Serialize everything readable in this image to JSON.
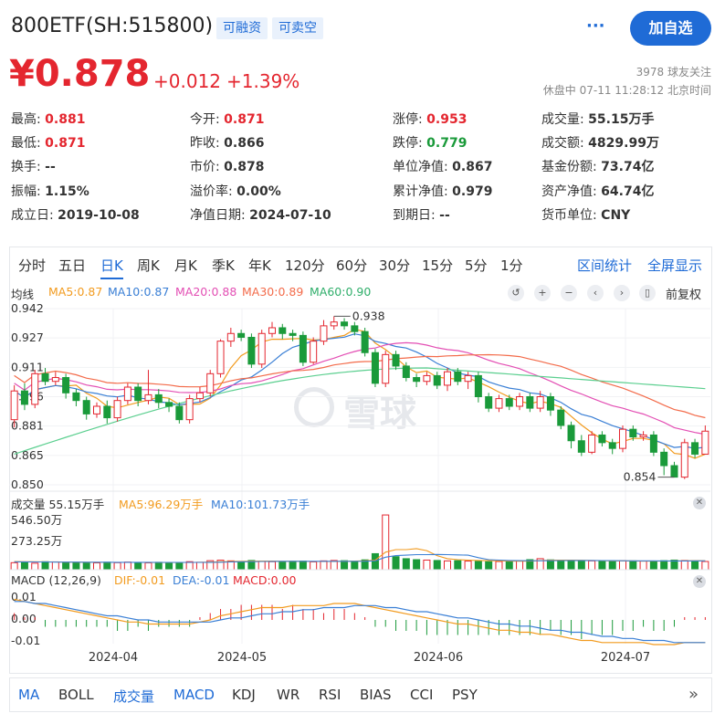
{
  "header": {
    "title": "800ETF(SH:515800)",
    "tags": [
      "可融资",
      "可卖空"
    ],
    "more": "···",
    "add_button": "加自选"
  },
  "quote": {
    "price": "¥0.878",
    "change": "+0.012",
    "change_pct": "+1.39%",
    "followers": "3978 球友关注",
    "status": "休盘中 07-11 11:28:12 北京时间"
  },
  "info": {
    "rows": [
      [
        {
          "label": "最高:",
          "value": "0.881",
          "color": "red"
        },
        {
          "label": "今开:",
          "value": "0.871",
          "color": "red"
        },
        {
          "label": "涨停:",
          "value": "0.953",
          "color": "red"
        },
        {
          "label": "成交量:",
          "value": "55.15万手",
          "color": "black"
        }
      ],
      [
        {
          "label": "最低:",
          "value": "0.871",
          "color": "red"
        },
        {
          "label": "昨收:",
          "value": "0.866",
          "color": "black"
        },
        {
          "label": "跌停:",
          "value": "0.779",
          "color": "green"
        },
        {
          "label": "成交额:",
          "value": "4829.99万",
          "color": "black"
        }
      ],
      [
        {
          "label": "换手:",
          "value": "--",
          "color": "black"
        },
        {
          "label": "市价:",
          "value": "0.878",
          "color": "black"
        },
        {
          "label": "单位净值:",
          "value": "0.867",
          "color": "black"
        },
        {
          "label": "基金份额:",
          "value": "73.74亿",
          "color": "black"
        }
      ],
      [
        {
          "label": "振幅:",
          "value": "1.15%",
          "color": "black"
        },
        {
          "label": "溢价率:",
          "value": "0.00%",
          "color": "black"
        },
        {
          "label": "累计净值:",
          "value": "0.979",
          "color": "black"
        },
        {
          "label": "资产净值:",
          "value": "64.74亿",
          "color": "black"
        }
      ],
      [
        {
          "label": "成立日:",
          "value": "2019-10-08",
          "color": "black"
        },
        {
          "label": "净值日期:",
          "value": "2024-07-10",
          "color": "black"
        },
        {
          "label": "到期日:",
          "value": "--",
          "color": "black"
        },
        {
          "label": "货币单位:",
          "value": "CNY",
          "color": "black"
        }
      ]
    ]
  },
  "period_tabs": [
    "分时",
    "五日",
    "日K",
    "周K",
    "月K",
    "季K",
    "年K",
    "120分",
    "60分",
    "30分",
    "15分",
    "5分",
    "1分"
  ],
  "active_period": "日K",
  "right_tabs": [
    "区间统计",
    "全屏显示"
  ],
  "ma_legend": {
    "title": "均线",
    "items": [
      "MA5:0.87",
      "MA10:0.87",
      "MA20:0.88",
      "MA30:0.89",
      "MA60:0.90"
    ],
    "restore": "前复权"
  },
  "volume_legend": {
    "title": "成交量 55.15万手",
    "ma5": "MA5:96.29万手",
    "ma10": "MA10:101.73万手"
  },
  "macd_legend": {
    "title": "MACD (12,26,9)",
    "dif": "DIF:-0.01",
    "dea": "DEA:-0.01",
    "macd": "MACD:0.00"
  },
  "watermark": "雪球",
  "colors": {
    "up": "#e4262f",
    "down": "#1a9a3a",
    "ma5": "#f29b1f",
    "ma10": "#3a7fd5",
    "ma20": "#e34fb4",
    "ma30": "#f36b4a",
    "ma60": "#5bcf8f",
    "accent": "#1f6bd6"
  },
  "bottom_tabs": [
    "MA",
    "BOLL",
    "成交量",
    "MACD",
    "KDJ",
    "WR",
    "RSI",
    "BIAS",
    "CCI",
    "PSY"
  ],
  "chart_data": {
    "type": "candlestick",
    "y_ticks": [
      "0.942",
      "0.927",
      "0.911",
      "0.896",
      "0.881",
      "0.865",
      "0.850"
    ],
    "ylim": [
      0.85,
      0.942
    ],
    "x_labels": [
      "2024-04",
      "2024-05",
      "2024-06",
      "2024-07"
    ],
    "max_label": "0.938",
    "min_label": "0.854",
    "candles": [
      [
        0.884,
        0.899,
        0.902,
        0.88
      ],
      [
        0.899,
        0.892,
        0.903,
        0.889
      ],
      [
        0.892,
        0.908,
        0.91,
        0.89
      ],
      [
        0.908,
        0.904,
        0.911,
        0.902
      ],
      [
        0.904,
        0.906,
        0.909,
        0.902
      ],
      [
        0.906,
        0.898,
        0.908,
        0.895
      ],
      [
        0.898,
        0.894,
        0.9,
        0.891
      ],
      [
        0.894,
        0.887,
        0.896,
        0.884
      ],
      [
        0.887,
        0.891,
        0.893,
        0.885
      ],
      [
        0.891,
        0.885,
        0.894,
        0.882
      ],
      [
        0.885,
        0.894,
        0.896,
        0.883
      ],
      [
        0.894,
        0.901,
        0.903,
        0.892
      ],
      [
        0.901,
        0.894,
        0.903,
        0.891
      ],
      [
        0.894,
        0.897,
        0.91,
        0.892
      ],
      [
        0.897,
        0.893,
        0.9,
        0.89
      ],
      [
        0.893,
        0.891,
        0.895,
        0.888
      ],
      [
        0.891,
        0.884,
        0.893,
        0.882
      ],
      [
        0.884,
        0.895,
        0.897,
        0.882
      ],
      [
        0.895,
        0.898,
        0.901,
        0.893
      ],
      [
        0.898,
        0.908,
        0.91,
        0.896
      ],
      [
        0.908,
        0.925,
        0.926,
        0.906
      ],
      [
        0.925,
        0.929,
        0.932,
        0.922
      ],
      [
        0.929,
        0.927,
        0.931,
        0.925
      ],
      [
        0.927,
        0.913,
        0.929,
        0.911
      ],
      [
        0.913,
        0.929,
        0.931,
        0.911
      ],
      [
        0.929,
        0.932,
        0.935,
        0.927
      ],
      [
        0.932,
        0.929,
        0.934,
        0.926
      ],
      [
        0.929,
        0.928,
        0.931,
        0.925
      ],
      [
        0.928,
        0.914,
        0.93,
        0.912
      ],
      [
        0.914,
        0.925,
        0.927,
        0.913
      ],
      [
        0.925,
        0.933,
        0.936,
        0.923
      ],
      [
        0.933,
        0.935,
        0.938,
        0.931
      ],
      [
        0.935,
        0.933,
        0.937,
        0.931
      ],
      [
        0.933,
        0.93,
        0.935,
        0.928
      ],
      [
        0.93,
        0.919,
        0.932,
        0.917
      ],
      [
        0.919,
        0.903,
        0.921,
        0.901
      ],
      [
        0.903,
        0.918,
        0.92,
        0.901
      ],
      [
        0.918,
        0.912,
        0.92,
        0.91
      ],
      [
        0.912,
        0.906,
        0.914,
        0.904
      ],
      [
        0.906,
        0.904,
        0.908,
        0.901
      ],
      [
        0.904,
        0.907,
        0.909,
        0.902
      ],
      [
        0.907,
        0.902,
        0.909,
        0.9
      ],
      [
        0.902,
        0.909,
        0.911,
        0.899
      ],
      [
        0.909,
        0.904,
        0.911,
        0.902
      ],
      [
        0.904,
        0.907,
        0.909,
        0.9
      ],
      [
        0.907,
        0.896,
        0.909,
        0.893
      ],
      [
        0.896,
        0.89,
        0.898,
        0.888
      ],
      [
        0.89,
        0.895,
        0.897,
        0.888
      ],
      [
        0.895,
        0.891,
        0.897,
        0.889
      ],
      [
        0.891,
        0.896,
        0.898,
        0.889
      ],
      [
        0.896,
        0.89,
        0.898,
        0.888
      ],
      [
        0.89,
        0.896,
        0.899,
        0.888
      ],
      [
        0.896,
        0.889,
        0.898,
        0.886
      ],
      [
        0.889,
        0.881,
        0.891,
        0.879
      ],
      [
        0.881,
        0.873,
        0.883,
        0.869
      ],
      [
        0.873,
        0.867,
        0.876,
        0.865
      ],
      [
        0.867,
        0.876,
        0.878,
        0.866
      ],
      [
        0.876,
        0.872,
        0.878,
        0.87
      ],
      [
        0.872,
        0.869,
        0.874,
        0.866
      ],
      [
        0.869,
        0.879,
        0.881,
        0.867
      ],
      [
        0.879,
        0.875,
        0.881,
        0.873
      ],
      [
        0.875,
        0.876,
        0.878,
        0.873
      ],
      [
        0.876,
        0.867,
        0.878,
        0.865
      ],
      [
        0.867,
        0.86,
        0.869,
        0.855
      ],
      [
        0.86,
        0.854,
        0.862,
        0.854
      ],
      [
        0.854,
        0.872,
        0.874,
        0.853
      ],
      [
        0.872,
        0.866,
        0.874,
        0.864
      ],
      [
        0.866,
        0.878,
        0.881,
        0.866
      ]
    ],
    "volume_ticks": [
      "546.50万",
      "273.25万"
    ],
    "volume_max": 546.5,
    "volumes": [
      70,
      72,
      65,
      80,
      78,
      75,
      72,
      70,
      68,
      75,
      70,
      76,
      72,
      68,
      74,
      70,
      66,
      80,
      74,
      90,
      95,
      88,
      78,
      92,
      85,
      80,
      76,
      84,
      86,
      78,
      88,
      92,
      90,
      86,
      98,
      160,
      546,
      130,
      110,
      100,
      96,
      92,
      88,
      90,
      86,
      84,
      80,
      82,
      86,
      88,
      100,
      110,
      98,
      92,
      90,
      86,
      88,
      84,
      82,
      90,
      88,
      86,
      84,
      90,
      96,
      92,
      88,
      82
    ],
    "volume_ma5": [
      82,
      80,
      79,
      78,
      77,
      76,
      76,
      75,
      74,
      73,
      73,
      73,
      73,
      72,
      72,
      72,
      72,
      73,
      74,
      76,
      79,
      82,
      84,
      85,
      86,
      86,
      84,
      84,
      83,
      82,
      82,
      83,
      84,
      86,
      88,
      95,
      175,
      200,
      200,
      210,
      190,
      140,
      110,
      100,
      96,
      92,
      90,
      88,
      86,
      85,
      86,
      90,
      95,
      96,
      96,
      94,
      92,
      90,
      88,
      88,
      87,
      86,
      86,
      86,
      87,
      88,
      90,
      89
    ],
    "volume_ma10": [
      78,
      78,
      77,
      77,
      76,
      76,
      76,
      75,
      75,
      75,
      74,
      74,
      74,
      74,
      73,
      73,
      73,
      73,
      73,
      74,
      75,
      77,
      79,
      80,
      82,
      83,
      84,
      84,
      84,
      84,
      84,
      84,
      84,
      84,
      85,
      88,
      125,
      140,
      145,
      150,
      150,
      152,
      150,
      148,
      145,
      120,
      100,
      96,
      92,
      90,
      89,
      89,
      90,
      91,
      92,
      92,
      92,
      91,
      90,
      89,
      88,
      88,
      88,
      87,
      87,
      87,
      88,
      88
    ],
    "macd_ticks": [
      "0.01",
      "0.00",
      "-0.01"
    ],
    "macd_range": [
      -0.012,
      0.012
    ],
    "dif": [
      0.01,
      0.009,
      0.008,
      0.007,
      0.006,
      0.005,
      0.004,
      0.003,
      0.002,
      0.001,
      0.0,
      -0.001,
      -0.001,
      -0.002,
      -0.002,
      -0.002,
      -0.002,
      -0.002,
      -0.001,
      0.0,
      0.002,
      0.003,
      0.004,
      0.005,
      0.006,
      0.006,
      0.006,
      0.007,
      0.007,
      0.007,
      0.007,
      0.008,
      0.008,
      0.008,
      0.007,
      0.006,
      0.005,
      0.004,
      0.003,
      0.002,
      0.001,
      0.0,
      -0.001,
      -0.002,
      -0.002,
      -0.003,
      -0.004,
      -0.005,
      -0.005,
      -0.006,
      -0.006,
      -0.007,
      -0.007,
      -0.008,
      -0.009,
      -0.01,
      -0.01,
      -0.011,
      -0.011,
      -0.011,
      -0.011,
      -0.011,
      -0.012,
      -0.012,
      -0.012,
      -0.011,
      -0.011,
      -0.011
    ],
    "dea": [
      0.009,
      0.009,
      0.008,
      0.008,
      0.007,
      0.006,
      0.005,
      0.004,
      0.003,
      0.002,
      0.002,
      0.001,
      0.0,
      0.0,
      -0.001,
      -0.001,
      -0.001,
      -0.001,
      -0.001,
      -0.001,
      0.0,
      0.001,
      0.001,
      0.002,
      0.003,
      0.003,
      0.004,
      0.004,
      0.005,
      0.005,
      0.006,
      0.006,
      0.006,
      0.007,
      0.007,
      0.007,
      0.006,
      0.006,
      0.005,
      0.004,
      0.004,
      0.003,
      0.002,
      0.001,
      0.001,
      0.0,
      -0.001,
      -0.002,
      -0.002,
      -0.003,
      -0.003,
      -0.004,
      -0.005,
      -0.005,
      -0.006,
      -0.006,
      -0.007,
      -0.008,
      -0.008,
      -0.009,
      -0.009,
      -0.01,
      -0.01,
      -0.01,
      -0.011,
      -0.011,
      -0.011,
      -0.011
    ]
  }
}
